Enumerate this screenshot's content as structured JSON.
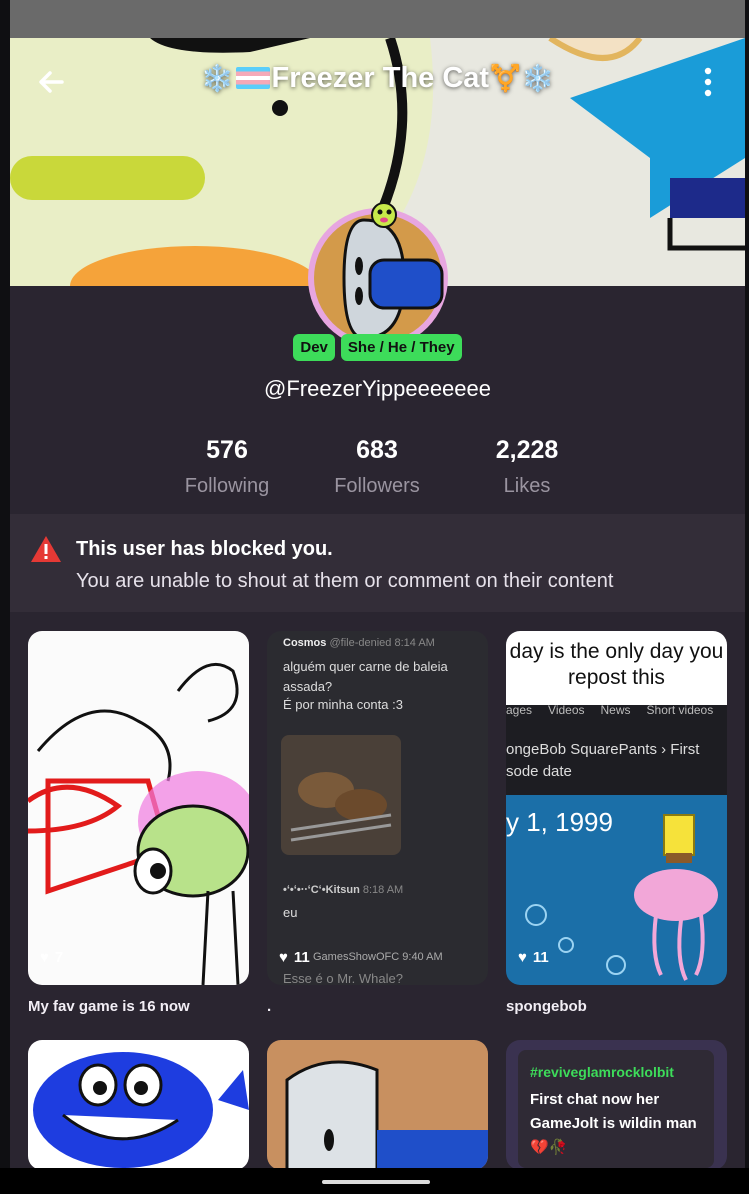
{
  "header": {
    "title": "Freezer The Cat",
    "title_prefix": "❄️",
    "title_suffix": "⚧️❄️",
    "back_icon": "arrow-left-icon",
    "menu_icon": "vertical-dots-icon"
  },
  "profile": {
    "badges": [
      "Dev",
      "She / He / They"
    ],
    "username": "@FreezerYippeeeeeee"
  },
  "stats": [
    {
      "value": "576",
      "label": "Following"
    },
    {
      "value": "683",
      "label": "Followers"
    },
    {
      "value": "2,228",
      "label": "Likes"
    }
  ],
  "alert": {
    "title": "This user has blocked you.",
    "message": "You are unable to shout at them or comment on their content",
    "icon": "warning-triangle-icon"
  },
  "posts": [
    {
      "likes": "7",
      "caption": "My fav game is 16 now"
    },
    {
      "likes": "11",
      "caption": ".",
      "chat": {
        "user1": "Cosmos",
        "handle1": "@file-denied",
        "time1": "8:14 AM",
        "msg1a": "alguém quer carne de baleia assada?",
        "msg1b": "É por minha conta :3",
        "user2": "•ʻ•ʻ•‧‧ʻCʻ•Kitsun",
        "time2": "8:18 AM",
        "msg2": "eu",
        "user3": "GamesShowOFC",
        "time3": "9:40 AM",
        "msg3": "Esse é o Mr. Whale?"
      }
    },
    {
      "likes": "11",
      "caption": "spongebob",
      "meme_top": "day is the only day you repost this",
      "tabs": [
        "ages",
        "Videos",
        "News",
        "Short videos"
      ],
      "result": "ongeBob SquarePants › First sode date",
      "date": "y 1, 1999"
    }
  ],
  "post_row2": {
    "hashtag": "#reviveglamrocklolbit",
    "text": "First chat now her GameJolt is wildin man 💔🥀"
  },
  "colors": {
    "background": "#2a2530",
    "badge": "#3ddc5a",
    "alert_icon": "#e53935"
  }
}
